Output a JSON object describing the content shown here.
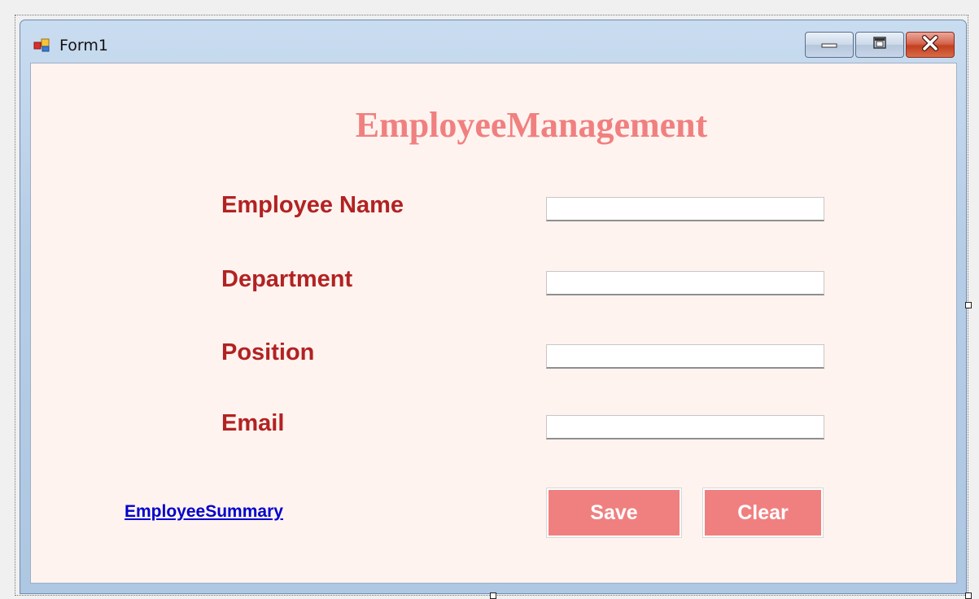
{
  "window": {
    "title": "Form1"
  },
  "form": {
    "heading": "EmployeeManagement",
    "fields": [
      {
        "label": "Employee Name",
        "value": "",
        "placeholder": ""
      },
      {
        "label": "Department",
        "value": "",
        "placeholder": ""
      },
      {
        "label": "Position",
        "value": "",
        "placeholder": ""
      },
      {
        "label": "Email",
        "value": "",
        "placeholder": ""
      }
    ],
    "summary_link": "EmployeeSummary",
    "save_label": "Save",
    "clear_label": "Clear"
  },
  "icons": {
    "app": "app-form-icon",
    "minimize": "minimize-icon",
    "maximize": "maximize-icon",
    "close": "close-icon"
  },
  "colors": {
    "heading": "#f08080",
    "labels": "#b22222",
    "form_background": "#fff3ef",
    "button_fill": "#f08080",
    "link": "#0000cc"
  }
}
